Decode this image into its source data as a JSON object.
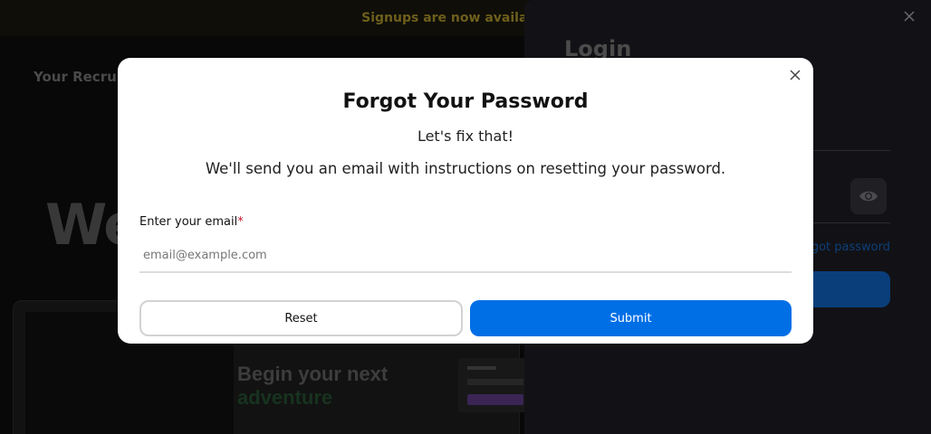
{
  "banner": {
    "text": "Signups are now available for BET"
  },
  "background": {
    "brand": "Your Recruit",
    "hero": "We",
    "card_heading_1": "Begin your next",
    "card_heading_2": "adventure"
  },
  "drawer": {
    "title": "Login",
    "forgot_link": "Forgot password?",
    "close_icon": "close-icon",
    "eye_icon": "eye-icon"
  },
  "modal": {
    "title": "Forgot Your Password",
    "subtitle": "Let's fix that!",
    "description": "We'll send you an email with instructions on resetting your password.",
    "email_label": "Enter your email",
    "required_marker": "*",
    "email_placeholder": "email@example.com",
    "email_value": "",
    "reset_label": "Reset",
    "submit_label": "Submit",
    "close_icon": "close-icon"
  },
  "colors": {
    "primary": "#006fe6",
    "required": "#d0142c",
    "overlay": "#0d0d10"
  }
}
